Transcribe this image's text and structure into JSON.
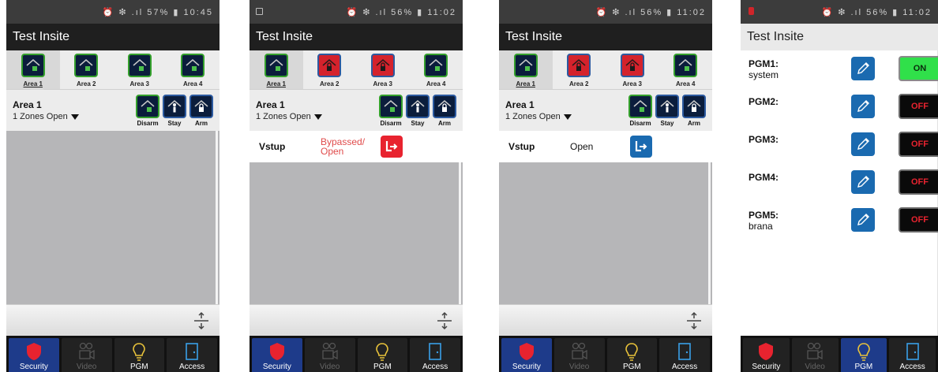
{
  "app_title": "Test Insite",
  "areas": [
    "Area 1",
    "Area 2",
    "Area 3",
    "Area 4"
  ],
  "area_header": {
    "name": "Area 1",
    "zones": "1 Zones Open"
  },
  "modes": {
    "disarm": "Disarm",
    "stay": "Stay",
    "arm": "Arm"
  },
  "nav": {
    "security": "Security",
    "video": "Video",
    "pgm": "PGM",
    "access": "Access"
  },
  "screens": [
    {
      "status": "⏰ ❇ .ıl 57% ▮ 10:45"
    },
    {
      "status": "⏰ ❇ .ıl 56% ▮ 11:02",
      "zone": {
        "name": "Vstup",
        "state": "Bypassed/ Open",
        "state_color": "#e04b4b"
      }
    },
    {
      "status": "⏰ ❇ .ıl 56% ▮ 11:02",
      "zone": {
        "name": "Vstup",
        "state": "Open"
      }
    },
    {
      "status": "⏰ ❇ .ıl 56% ▮ 11:02"
    }
  ],
  "pgm": [
    {
      "name": "PGM1:",
      "sub": "system",
      "state": "ON"
    },
    {
      "name": "PGM2:",
      "sub": "",
      "state": "OFF"
    },
    {
      "name": "PGM3:",
      "sub": "",
      "state": "OFF"
    },
    {
      "name": "PGM4:",
      "sub": "",
      "state": "OFF"
    },
    {
      "name": "PGM5:",
      "sub": "brana",
      "state": "OFF"
    }
  ],
  "colors": {
    "accent_blue": "#1a6ab0",
    "alarm_red": "#e8232f",
    "on_green": "#30e04a",
    "nav_active": "#1e3b8a"
  }
}
